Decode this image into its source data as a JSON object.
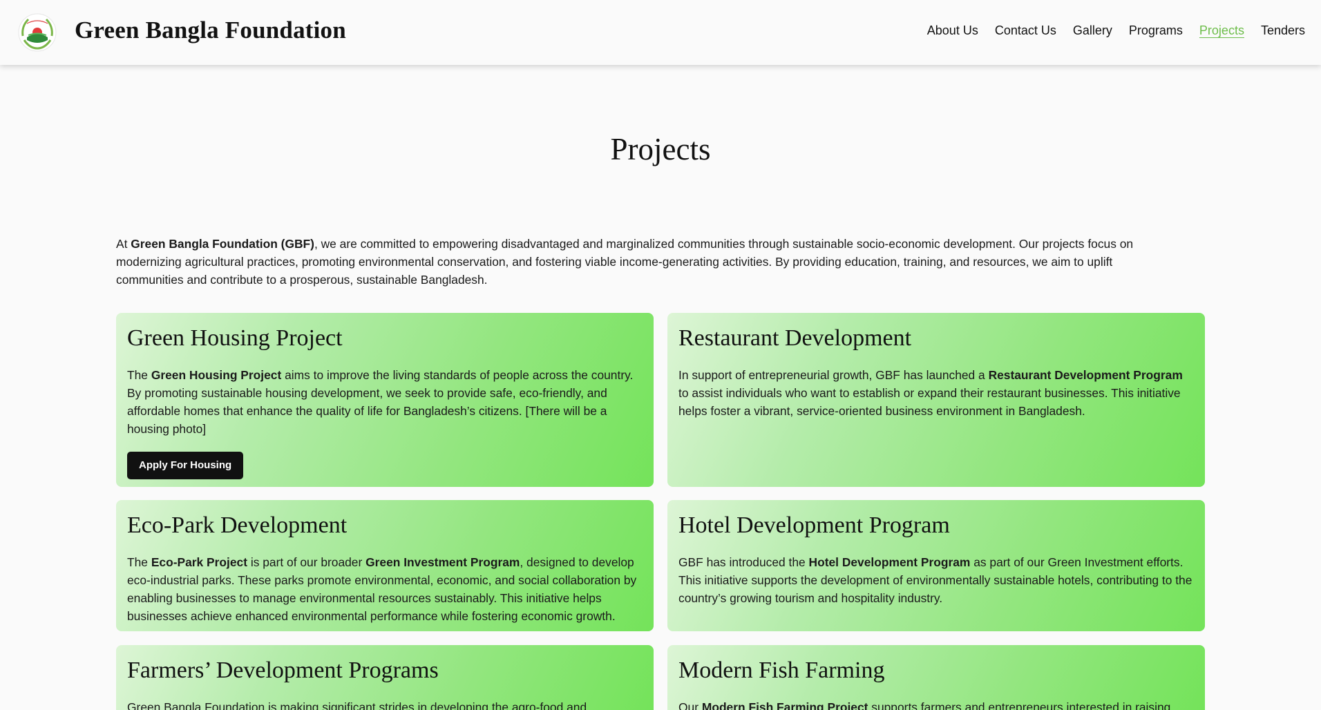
{
  "brand": {
    "name": "Green Bangla Foundation",
    "logo_icon": "gbf-logo-icon"
  },
  "nav": {
    "items": [
      {
        "label": "About Us",
        "active": false
      },
      {
        "label": "Contact Us",
        "active": false
      },
      {
        "label": "Gallery",
        "active": false
      },
      {
        "label": "Programs",
        "active": false
      },
      {
        "label": "Projects",
        "active": true
      },
      {
        "label": "Tenders",
        "active": false
      }
    ],
    "active_color": "#6dbd4a"
  },
  "page": {
    "title": "Projects",
    "intro": {
      "prefix": "At ",
      "org_bold": "Green Bangla Foundation (GBF)",
      "rest": ", we are committed to empowering disadvantaged and marginalized communities through sustainable socio-economic development. Our projects focus on modernizing agricultural practices, promoting environmental conservation, and fostering viable income-generating activities. By providing education, training, and resources, we aim to uplift communities and contribute to a prosperous, sustainable Bangladesh."
    }
  },
  "cards": {
    "green_housing": {
      "title": "Green Housing Project",
      "p1": "The ",
      "b1": "Green Housing Project",
      "p2": " aims to improve the living standards of people across the country. By promoting sustainable housing development, we seek to provide safe, eco-friendly, and affordable homes that enhance the quality of life for Bangladesh’s citizens. [There will be a housing photo]",
      "button": "Apply For Housing"
    },
    "restaurant": {
      "title": "Restaurant Development",
      "p1": "In support of entrepreneurial growth, GBF has launched a ",
      "b1": "Restaurant Development Program",
      "p2": " to assist individuals who want to establish or expand their restaurant businesses. This initiative helps foster a vibrant, service-oriented business environment in Bangladesh."
    },
    "eco_park": {
      "title": "Eco-Park Development",
      "p1": "The ",
      "b1": "Eco-Park Project",
      "p2": " is part of our broader ",
      "b2": "Green Investment Program",
      "p3": ", designed to develop eco-industrial parks. These parks promote environmental, economic, and social collaboration by enabling businesses to manage environmental resources sustainably. This initiative helps businesses achieve enhanced environmental performance while fostering economic growth."
    },
    "hotel": {
      "title": "Hotel Development Program",
      "p1": "GBF has introduced the ",
      "b1": "Hotel Development Program",
      "p2": " as part of our Green Investment efforts. This initiative supports the development of environmentally sustainable hotels, contributing to the country’s growing tourism and hospitality industry."
    },
    "farmers": {
      "title": "Farmers’ Development Programs",
      "p1": "Green Bangla Foundation is making significant strides in developing the agro-food and"
    },
    "fish": {
      "title": "Modern Fish Farming",
      "p1": "Our ",
      "b1": "Modern Fish Farming Project",
      "p2": " supports farmers and entrepreneurs interested in raising"
    }
  },
  "colors": {
    "card_gradient_start": "#ddf5d6",
    "card_gradient_end": "#74e35a",
    "button_bg": "#111111",
    "background": "#fafafa"
  }
}
